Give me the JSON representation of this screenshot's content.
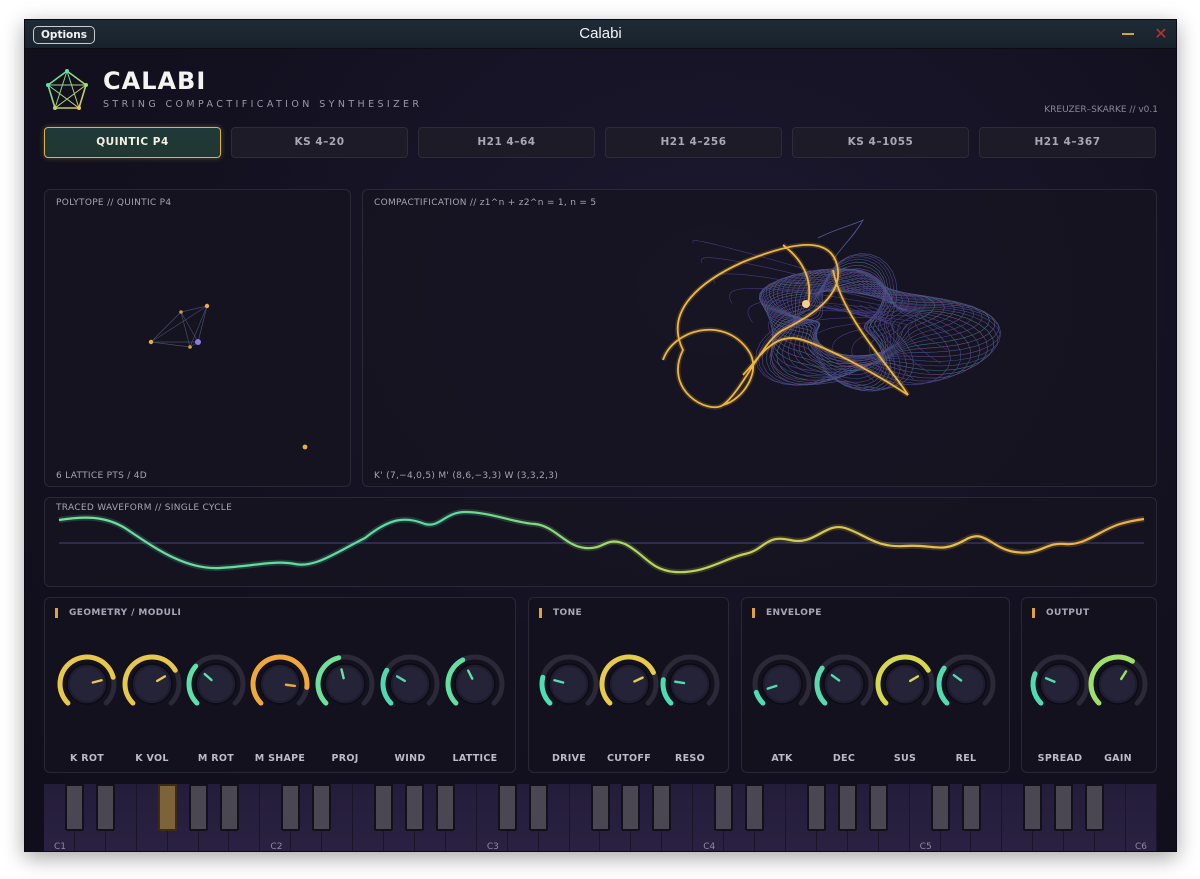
{
  "window": {
    "title": "Calabi",
    "options_label": "Options",
    "close_glyph": "✕"
  },
  "brand": {
    "name": "CALABI",
    "subtitle": "STRING COMPACTIFICATION SYNTHESIZER",
    "version": "KREUZER–SKARKE // v0.1",
    "logo_icon": "polytope-icon"
  },
  "presets": [
    {
      "label": "QUINTIC P4",
      "active": true
    },
    {
      "label": "KS 4–20",
      "active": false
    },
    {
      "label": "H21 4–64",
      "active": false
    },
    {
      "label": "H21 4–256",
      "active": false
    },
    {
      "label": "KS 4–1055",
      "active": false
    },
    {
      "label": "H21 4–367",
      "active": false
    }
  ],
  "polytope": {
    "title": "POLYTOPE // QUINTIC P4",
    "footer": "6 LATTICE PTS / 4D"
  },
  "compactification": {
    "title": "COMPACTIFICATION // z1^n + z2^n = 1, n = 5",
    "footer": "K' (7,−4,0,5)   M' (8,6,−3,3)   W (3,3,2,3)"
  },
  "waveform": {
    "title": "TRACED WAVEFORM // SINGLE CYCLE"
  },
  "sections": [
    {
      "title": "GEOMETRY / MODULI",
      "knobs": [
        {
          "label": "K ROT",
          "value": 0.78,
          "color": "#e8c84a"
        },
        {
          "label": "K VOL",
          "value": 0.72,
          "color": "#e6c84c"
        },
        {
          "label": "M ROT",
          "value": 0.32,
          "color": "#5ee0a8"
        },
        {
          "label": "M SHAPE",
          "value": 0.86,
          "color": "#f0a83a"
        },
        {
          "label": "PROJ",
          "value": 0.45,
          "color": "#6ee09a"
        },
        {
          "label": "WIND",
          "value": 0.28,
          "color": "#52d8b0"
        },
        {
          "label": "LATTICE",
          "value": 0.4,
          "color": "#62e0a2"
        }
      ]
    },
    {
      "title": "TONE",
      "knobs": [
        {
          "label": "DRIVE",
          "value": 0.22,
          "color": "#4ee0b4"
        },
        {
          "label": "CUTOFF",
          "value": 0.74,
          "color": "#e6cc4a"
        },
        {
          "label": "RESO",
          "value": 0.2,
          "color": "#4edcb2"
        }
      ]
    },
    {
      "title": "ENVELOPE",
      "knobs": [
        {
          "label": "ATK",
          "value": 0.1,
          "color": "#4edcb2"
        },
        {
          "label": "DEC",
          "value": 0.3,
          "color": "#54dcae"
        },
        {
          "label": "SUS",
          "value": 0.72,
          "color": "#d8d84e"
        },
        {
          "label": "REL",
          "value": 0.3,
          "color": "#52dcae"
        }
      ]
    },
    {
      "title": "OUTPUT",
      "knobs": [
        {
          "label": "SPREAD",
          "value": 0.25,
          "color": "#4edcb2"
        },
        {
          "label": "GAIN",
          "value": 0.62,
          "color": "#9ee06a"
        }
      ]
    }
  ],
  "keyboard": {
    "octave_labels": [
      "C1",
      "C2",
      "C3",
      "C4",
      "C5",
      "C6"
    ],
    "active_black_key_index": 2
  },
  "colors": {
    "accent": "#d8b54c",
    "bg": "#141220",
    "wave_green": "#56e0a0",
    "wave_gold": "#f0b83c"
  }
}
